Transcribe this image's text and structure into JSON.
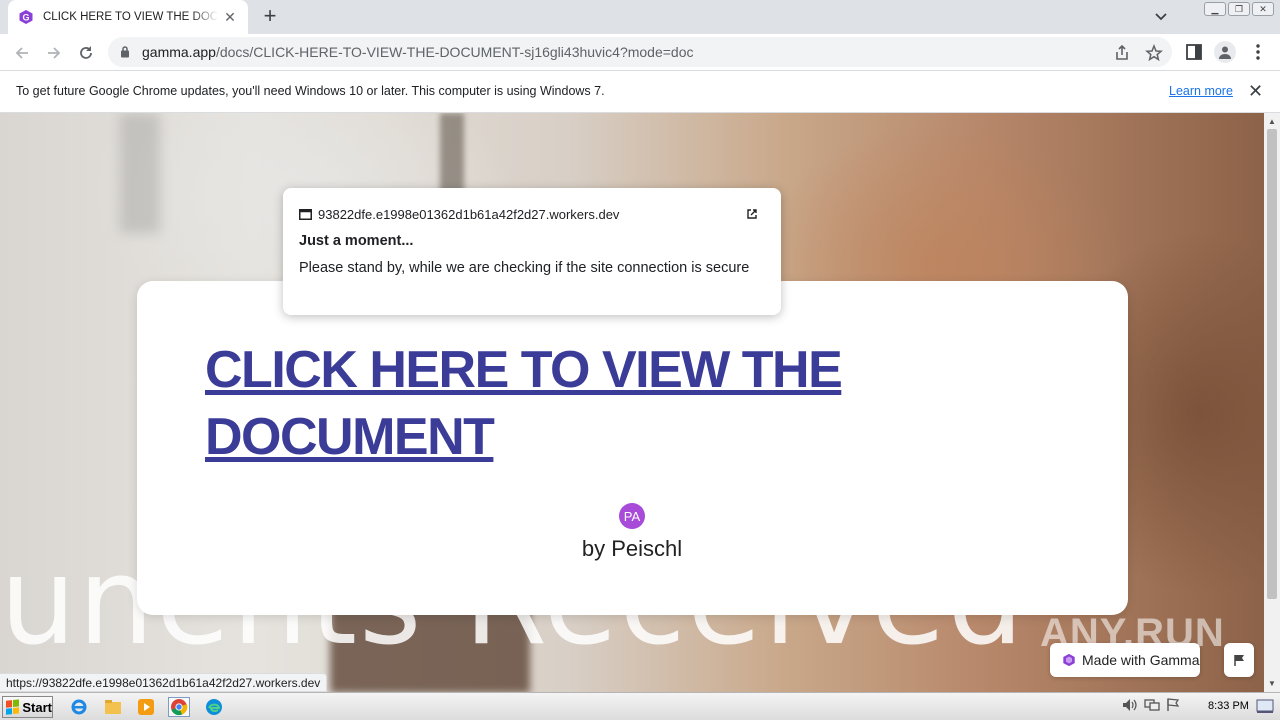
{
  "browser": {
    "tab_title": "CLICK HERE TO VIEW THE DOCUMENT",
    "url_host": "gamma.app",
    "url_path": "/docs/CLICK-HERE-TO-VIEW-THE-DOCUMENT-sj16gli43huvic4?mode=doc",
    "new_tab_symbol": "+",
    "tab_close_symbol": "✕"
  },
  "infobar": {
    "message": "To get future Google Chrome updates, you'll need Windows 10 or later. This computer is using Windows 7.",
    "link": "Learn more",
    "close_symbol": "✕"
  },
  "page": {
    "headline": "CLICK HERE TO VIEW THE DOCUMENT",
    "avatar_initials": "PA",
    "byline": "by Peischl",
    "background_text": "unents Received",
    "badge_label": "Made with Gamma",
    "watermark": "ANY.RUN"
  },
  "popup": {
    "site": "93822dfe.e1998e01362d1b61a42f2d27.workers.dev",
    "title": "Just a moment...",
    "message": "Please stand by, while we are checking if the site connection is secure"
  },
  "status_url": "https://93822dfe.e1998e01362d1b61a42f2d27.workers.dev",
  "taskbar": {
    "start_label": "Start",
    "clock": "8:33 PM"
  },
  "colors": {
    "headline": "#3b3b98",
    "avatar": "#a84bd8",
    "link": "#1a73e8",
    "gamma_logo": "#8b3fd9"
  }
}
